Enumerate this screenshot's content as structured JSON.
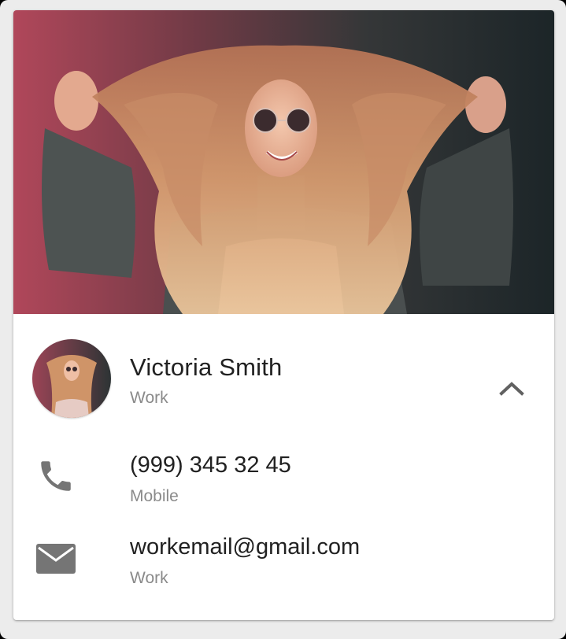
{
  "contact": {
    "name": "Victoria Smith",
    "subtitle": "Work",
    "photo": "woman-with-long-hair-and-sunglasses"
  },
  "phone": {
    "value": "(999) 345 32 45",
    "label": "Mobile",
    "icon": "phone-icon"
  },
  "email": {
    "value": "workemail@gmail.com",
    "label": "Work",
    "icon": "email-icon"
  },
  "actions": {
    "collapse_icon": "chevron-up-icon"
  },
  "colors": {
    "primary_text": "#212121",
    "secondary_text": "#8a8a8a",
    "icon": "#757575",
    "card_bg": "#ffffff",
    "page_bg": "#ececec"
  }
}
